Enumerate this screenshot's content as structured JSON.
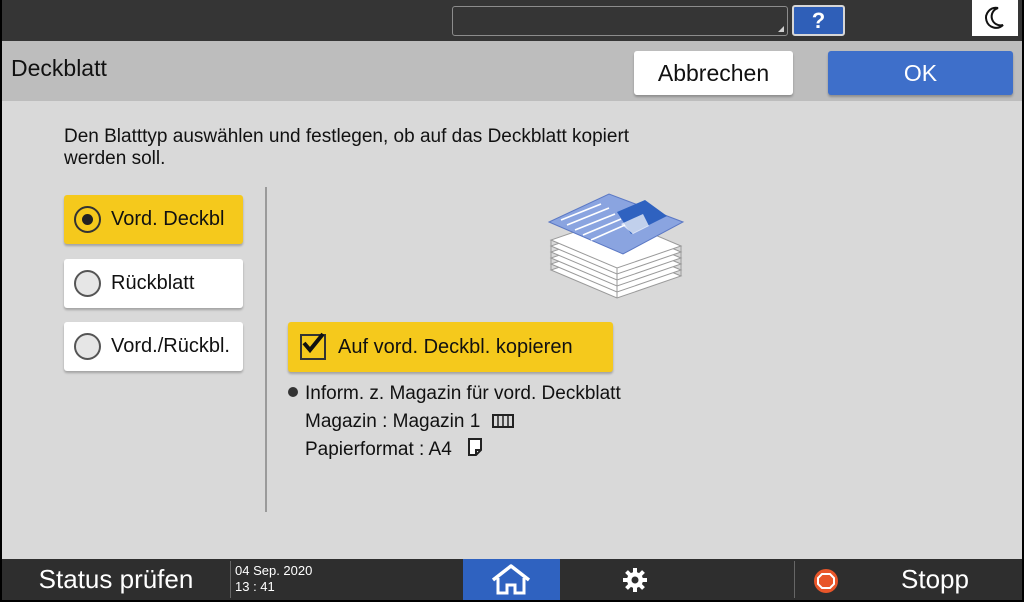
{
  "topbar": {
    "help_label": "?",
    "help_icon": "question-icon",
    "energy_icon": "moon-icon"
  },
  "header": {
    "title": "Deckblatt",
    "cancel_label": "Abbrechen",
    "ok_label": "OK"
  },
  "main": {
    "instruction": "Den Blatttyp auswählen und festlegen, ob auf das Deckblatt kopiert werden soll.",
    "options": [
      {
        "label": "Vord. Deckbl",
        "selected": true
      },
      {
        "label": "Rückblatt",
        "selected": false
      },
      {
        "label": "Vord./Rückbl.",
        "selected": false
      }
    ],
    "copy_checkbox": {
      "label": "Auf vord. Deckbl. kopieren",
      "checked": true
    },
    "info": {
      "heading": "Inform. z. Magazin für vord. Deckblatt",
      "tray": "Magazin : Magazin 1",
      "paper": "Papierformat : A4"
    }
  },
  "bottombar": {
    "status_label": "Status prüfen",
    "date": "04 Sep. 2020",
    "time": "13 : 41",
    "home_icon": "home-icon",
    "settings_icon": "gear-icon",
    "stop_label": "Stopp",
    "stop_icon": "stop-icon"
  },
  "colors": {
    "selected": "#f5c91c",
    "primary": "#3e6fca",
    "home": "#2f62c0",
    "bar": "#2e2e2e"
  }
}
